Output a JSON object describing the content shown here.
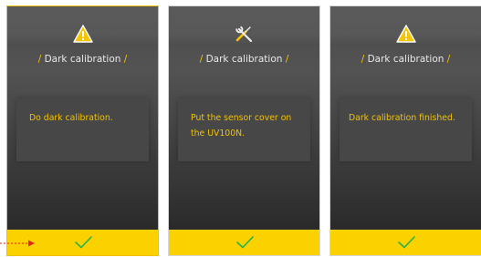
{
  "screens": [
    {
      "icon": "warning-icon",
      "title_slash_left": "/",
      "title": "Dark calibration",
      "title_slash_right": "/",
      "message": "Do dark calibration.",
      "confirm_icon": "checkmark-icon"
    },
    {
      "icon": "tools-icon",
      "title_slash_left": "/",
      "title": "Dark calibration",
      "title_slash_right": "/",
      "message": "Put the sensor cover on the UV100N.",
      "confirm_icon": "checkmark-icon"
    },
    {
      "icon": "warning-icon",
      "title_slash_left": "/",
      "title": "Dark calibration",
      "title_slash_right": "/",
      "message": "Dark calibration finished.",
      "confirm_icon": "checkmark-icon"
    }
  ],
  "annotation": {
    "arrow_icon": "dashed-arrow-icon",
    "color": "#e2231a"
  },
  "colors": {
    "accent_yellow": "#fbd100",
    "text_yellow": "#f2c200",
    "check_green": "#27b24a"
  }
}
